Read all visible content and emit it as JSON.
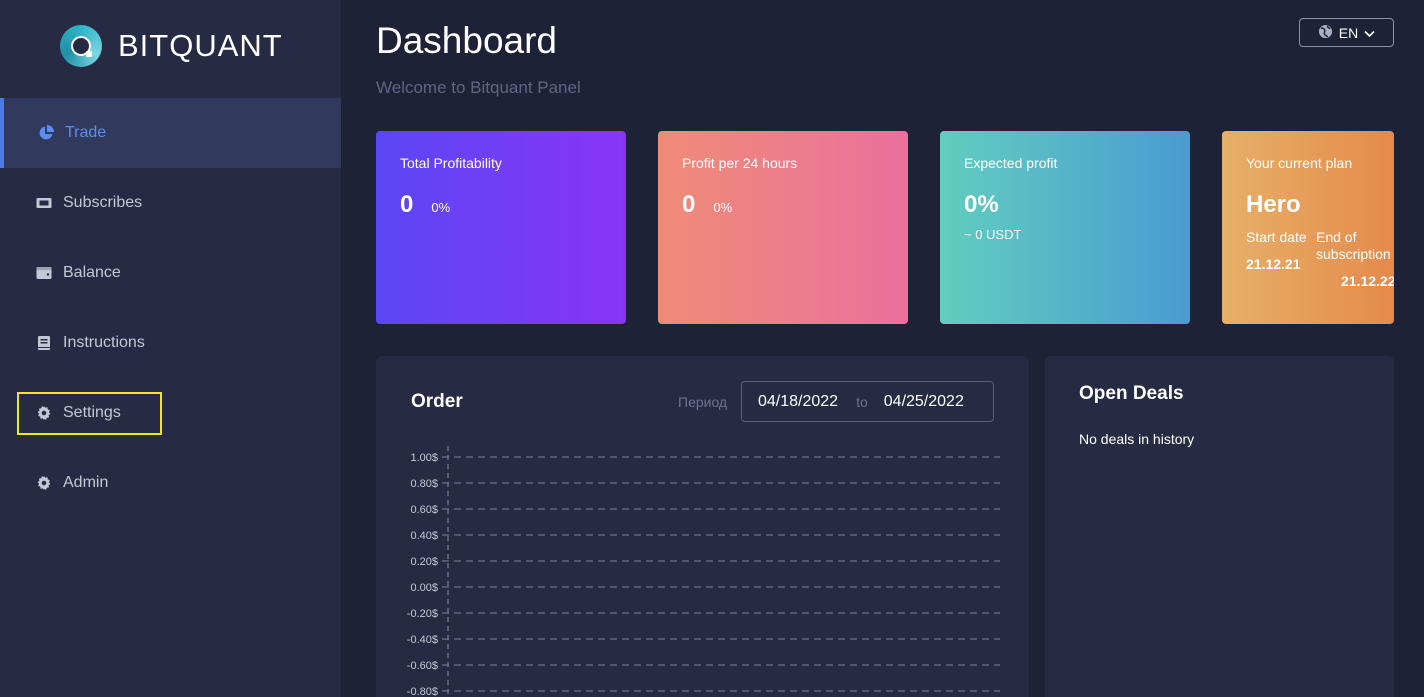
{
  "brand": {
    "name": "BITQUANT"
  },
  "sidebar": {
    "items": [
      {
        "label": "Trade",
        "icon": "pie-chart-icon"
      },
      {
        "label": "Subscribes",
        "icon": "ticket-icon"
      },
      {
        "label": "Balance",
        "icon": "wallet-icon"
      },
      {
        "label": "Instructions",
        "icon": "book-icon"
      },
      {
        "label": "Settings",
        "icon": "gear-icon"
      },
      {
        "label": "Admin",
        "icon": "gear-icon"
      }
    ],
    "active": "Trade",
    "highlight": "Settings"
  },
  "header": {
    "title": "Dashboard",
    "subtitle": "Welcome to Bitquant Panel",
    "language": "EN"
  },
  "cards": {
    "total": {
      "title": "Total Profitability",
      "value": "0",
      "percent": "0%"
    },
    "daily": {
      "title": "Profit per 24 hours",
      "value": "0",
      "percent": "0%"
    },
    "expected": {
      "title": "Expected profit",
      "value": "0%",
      "sub": "~ 0 USDT"
    },
    "plan": {
      "title": "Your current plan",
      "name": "Hero",
      "start_label": "Start date",
      "end_label": "End of subscription",
      "start_value": "21.12.21",
      "end_value": "21.12.22"
    }
  },
  "order": {
    "title": "Order",
    "period_label": "Период",
    "date_from": "04/18/2022",
    "to_label": "to",
    "date_to": "04/25/2022"
  },
  "deals": {
    "title": "Open Deals",
    "empty": "No deals in history"
  },
  "colors": {
    "background": "#1d2236",
    "sidebar": "#262b43",
    "accent": "#5b8def",
    "highlight": "#f2e52a"
  },
  "chart_data": {
    "type": "line",
    "ylim": [
      -0.8,
      1.0
    ],
    "y_ticks": [
      "1.00$",
      "0.80$",
      "0.60$",
      "0.40$",
      "0.20$",
      "0.00$",
      "-0.20$",
      "-0.40$",
      "-0.60$",
      "-0.80$"
    ],
    "series": [],
    "grid": true
  }
}
